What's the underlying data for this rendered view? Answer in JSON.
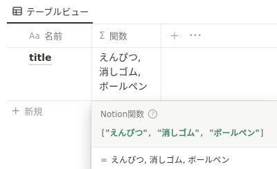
{
  "tab": {
    "label": "テーブルビュー",
    "icon": "table-icon"
  },
  "columns": {
    "name": {
      "icon_text": "Aa",
      "label": "名前"
    },
    "function": {
      "icon_text": "Σ",
      "label": "関数"
    },
    "add_icon": "＋",
    "more_icon": "•••"
  },
  "row": {
    "title": "title",
    "function_value": [
      "えんぴつ,",
      "消しゴム,",
      "ボールペン"
    ]
  },
  "new_row": {
    "plus": "+",
    "label": "新規"
  },
  "popup": {
    "title": "Notion関数",
    "help_icon": "?",
    "formula": {
      "open": "[",
      "items": [
        "\"えんぴつ\"",
        "\"消しゴム\"",
        "\"ボールペン\""
      ],
      "sep": ",",
      "close": "]"
    },
    "result_prefix": "=",
    "result": "えんぴつ, 消しゴム, ボールペン"
  }
}
